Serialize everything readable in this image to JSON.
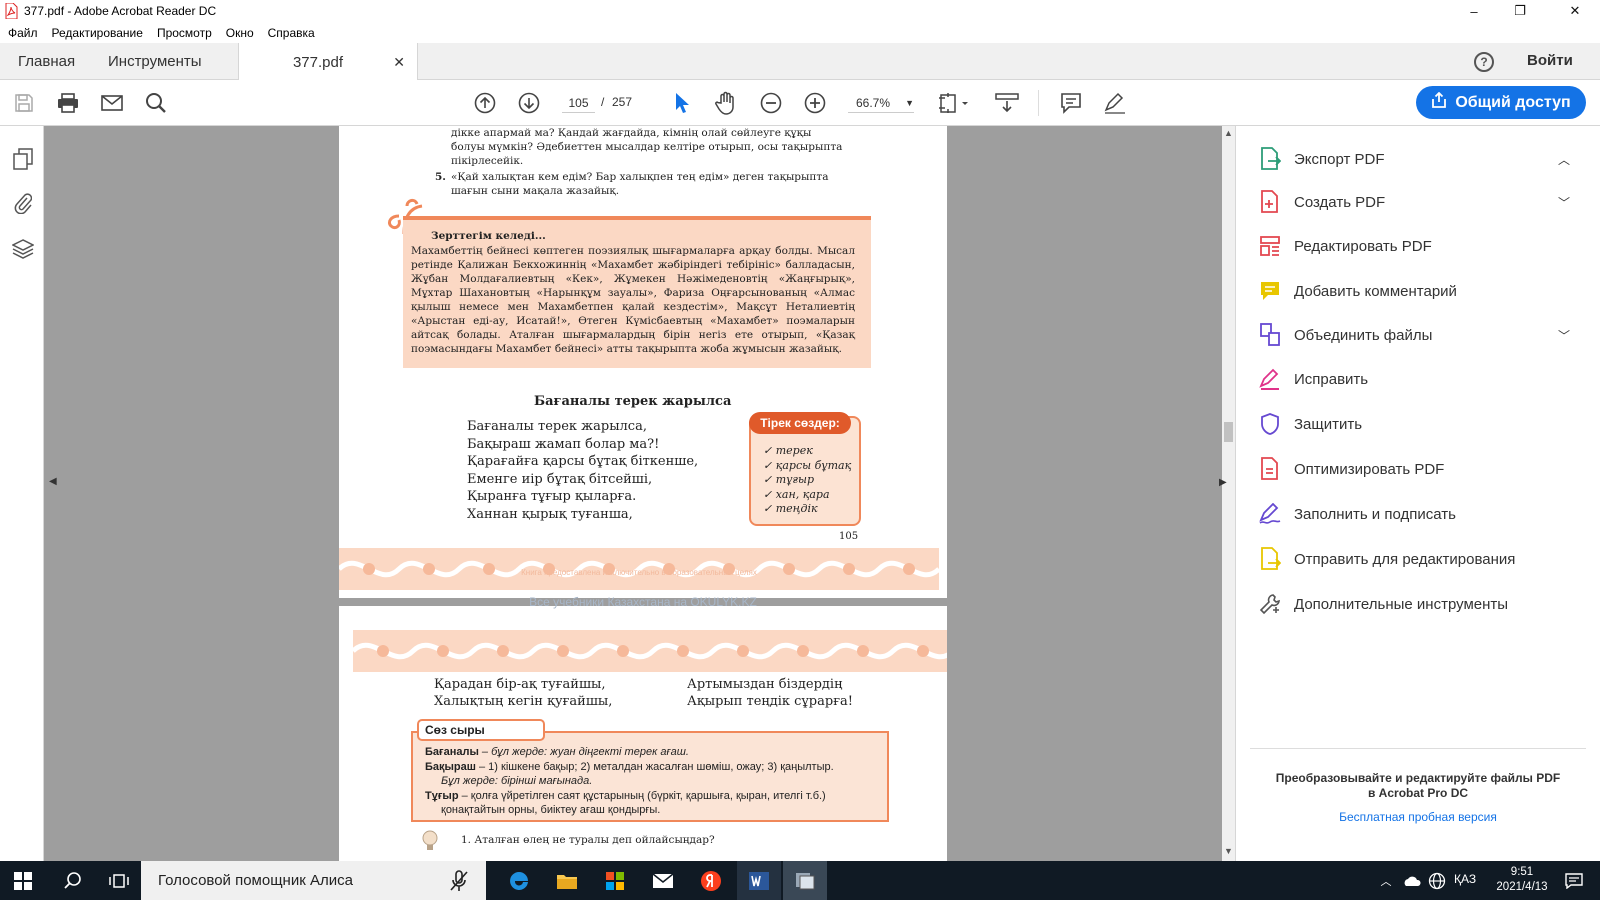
{
  "window": {
    "title": "377.pdf - Adobe Acrobat Reader DC",
    "minimize": "–",
    "maximize": "❐",
    "close": "✕"
  },
  "menu": [
    "Файл",
    "Редактирование",
    "Просмотр",
    "Окно",
    "Справка"
  ],
  "tabs": {
    "home": "Главная",
    "tools": "Инструменты",
    "document": "377.pdf",
    "close": "✕",
    "sign_in": "Войти",
    "help": "?"
  },
  "toolbar": {
    "current_page": "105",
    "page_sep": "/",
    "total_pages": "257",
    "zoom": "66.7%",
    "share_label": "Общий доступ"
  },
  "page1": {
    "intro_lines": [
      "діккe апармай ма? Қандай жағдайда, кімнің олай сөйлеуге құқы",
      "болуы мүмкін? Әдебиеттен мысалдар келтіре отырып, осы тақырыпта",
      "пікірлесейік."
    ],
    "item5_num": "5.",
    "item5_lines": [
      "«Қай халықтан кем едім? Бар халықпен тең едім» деген тақырыпта",
      "шағын сыни мақала жазайық."
    ],
    "research_title": "Зерттегім келеді...",
    "research_body": "Махамбеттің бейнесі көптеген поэзиялық шығармаларға арқау болды. Мысал ретінде Қалижан Бекхожиннің «Махамбет жәбіріндегі тебірініс» балладасын, Жұбан Молдағалиевтың «Кек», Жұмекен Нәжімеденовтің «Жаңғырық», Мұхтар Шахановтың «Нарынқұм зауалы», Фариза Оңғарсынованың «Алмас қылыш немесе мен Махамбетпен қалай кездестім», Мақсұт Неталиевтің «Арыстан еді-ау, Исатай!», Өтеген Күмісбаевтың «Махамбет» поэмаларын айтсақ болады. Аталған шығармалардың бірін негіз ете отырып, «Қазақ поэмасындағы Махамбет бейнесі» атты тақырыпта жоба жұмысын жазайық.",
    "poem_title": "Бағаналы терек жарылса",
    "poem_lines": [
      "Бағаналы терек жарылса,",
      "Бақыраш жамап болар ма?!",
      "Қарағайға қарсы бұтақ біткенше,",
      "Еменге иір бұтақ бітсейші,",
      "Қыранға тұғыр қыларға.",
      "Ханнан қырық туғанша,"
    ],
    "support_title": "Тірек сөздер:",
    "support_words": [
      "терек",
      "қарсы бұтақ",
      "тұғыр",
      "хан, қара",
      "теңдік"
    ],
    "page_number": "105",
    "watermark": "Книга предоставлена исключительно в образовательных целях"
  },
  "between_watermark": "Все учебники Казахстана на OKULYK.KZ",
  "page2": {
    "poem_left": [
      "Қарадан бір-ақ туғайшы,",
      "Халықтың кегін қуғайшы,"
    ],
    "poem_right": [
      "Артымыздан біздердің",
      "Ақырып теңдік сұрарға!"
    ],
    "words_tag": "Сөз сыры",
    "words": [
      {
        "term": "Бағаналы",
        "text": " – бұл жерде: жуан діңгекті терек ағаш."
      },
      {
        "term": "Бақыраш",
        "text": " – 1) кішкене бақыр; 2) металдан жасалған шөміш, ожау; 3) қаңылтыр."
      },
      {
        "term": "",
        "text": "Бұл жерде: бірінші мағынада."
      },
      {
        "term": "Тұғыр",
        "text": " – қолға үйретілген саят құстарының (бүркіт, қаршыға, қыран, ителгі т.б.)"
      },
      {
        "term": "",
        "text": "қонақтайтын орны, биіктеу ағаш қондырғы."
      }
    ],
    "q1": "1. Аталған өлең не туралы деп ойлайсыңдар?"
  },
  "right_panel": {
    "tools": [
      {
        "label": "Экспорт PDF",
        "chevron": "up",
        "color": "#2d9d78"
      },
      {
        "label": "Создать PDF",
        "chevron": "down",
        "color": "#e34850"
      },
      {
        "label": "Редактировать PDF",
        "chevron": "",
        "color": "#e34850"
      },
      {
        "label": "Добавить комментарий",
        "chevron": "",
        "color": "#e8c600"
      },
      {
        "label": "Объединить файлы",
        "chevron": "down",
        "color": "#6649d1"
      },
      {
        "label": "Исправить",
        "chevron": "",
        "color": "#e0338a"
      },
      {
        "label": "Защитить",
        "chevron": "",
        "color": "#6649d1"
      },
      {
        "label": "Оптимизировать PDF",
        "chevron": "",
        "color": "#e34850"
      },
      {
        "label": "Заполнить и подписать",
        "chevron": "",
        "color": "#6649d1"
      },
      {
        "label": "Отправить для редактирования",
        "chevron": "",
        "color": "#e8c600"
      },
      {
        "label": "Дополнительные инструменты",
        "chevron": "",
        "color": "#555555"
      }
    ],
    "promo_line1": "Преобразовывайте и редактируйте файлы PDF",
    "promo_line2": "в Acrobat Pro DC",
    "promo_link": "Бесплатная пробная версия"
  },
  "taskbar": {
    "search_text": "Голосовой помощник Алиса",
    "language": "ҚАЗ",
    "time": "9:51",
    "date": "2021/4/13"
  },
  "colors": {
    "accent": "#1473e6",
    "ornament": "#f6b99a",
    "taskbar": "#101a24"
  }
}
